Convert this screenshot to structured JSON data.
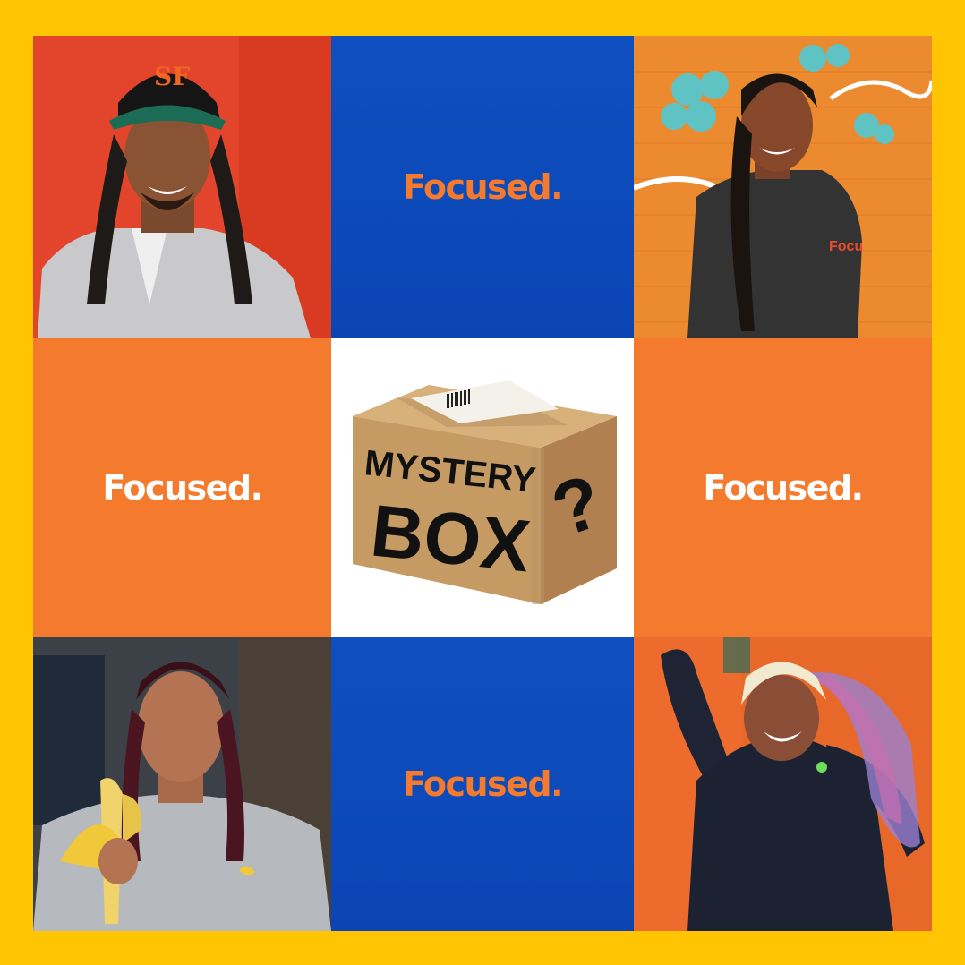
{
  "tagline_top": "Focused.",
  "tagline_left": "Focused.",
  "tagline_right": "Focused.",
  "tagline_bottom": "Focused.",
  "mystery_box": {
    "line1": "MYSTERY",
    "line2": "BOX",
    "mark": "?"
  },
  "shirt_text": "Focu",
  "cap_logo": "SF",
  "colors": {
    "frame": "#FFC402",
    "blue": "#0B47B8",
    "orange": "#F47A2D",
    "white": "#FFFFFF",
    "cardboard": "#C9A06A"
  }
}
